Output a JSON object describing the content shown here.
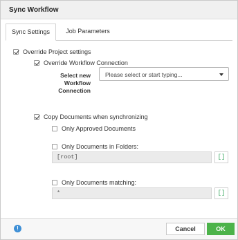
{
  "dialog": {
    "title": "Sync Workflow"
  },
  "tabs": [
    {
      "label": "Sync Settings",
      "active": true
    },
    {
      "label": "Job Parameters",
      "active": false
    }
  ],
  "settings": {
    "override_project": {
      "label": "Override Project settings",
      "checked": true
    },
    "override_workflow": {
      "label": "Override Workflow Connection",
      "checked": true
    },
    "select_label": "Select new Workflow Connection",
    "select_placeholder": "Please select or start typing...",
    "copy_documents": {
      "label": "Copy Documents when synchronizing",
      "checked": true
    },
    "only_approved": {
      "label": "Only Approved Documents",
      "checked": false
    },
    "only_in_folders": {
      "label": "Only Documents in Folders:",
      "checked": false,
      "value": "[root]",
      "button": "[]"
    },
    "only_matching": {
      "label": "Only Documents matching:",
      "checked": false,
      "value": "*",
      "button": "[]"
    }
  },
  "footer": {
    "help_icon": "info-icon",
    "help_glyph": "!",
    "cancel_label": "Cancel",
    "ok_label": "OK"
  },
  "colors": {
    "ok_button": "#4cb34a",
    "bracket_button_text": "#3aa660",
    "help_icon": "#3d8fd6"
  }
}
